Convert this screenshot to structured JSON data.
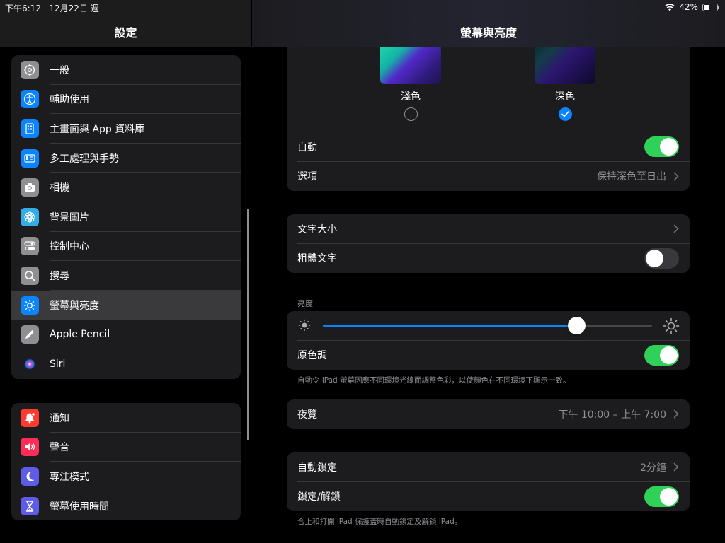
{
  "status": {
    "time": "下午6:12",
    "date": "12月22日 週一",
    "battery": "42%",
    "battery_level": 0.42
  },
  "sidebar": {
    "title": "設定",
    "group1": [
      {
        "label": "一般",
        "icon": "gear-icon",
        "color": "#8e8e93"
      },
      {
        "label": "輔助使用",
        "icon": "accessibility-icon",
        "color": "#0a84ff"
      },
      {
        "label": "主畫面與 App 資料庫",
        "icon": "home-screen-icon",
        "color": "#0a84ff"
      },
      {
        "label": "多工處理與手勢",
        "icon": "multitasking-icon",
        "color": "#0a84ff"
      },
      {
        "label": "相機",
        "icon": "camera-icon",
        "color": "#8e8e93"
      },
      {
        "label": "背景圖片",
        "icon": "flower-icon",
        "color": "#32ade6"
      },
      {
        "label": "控制中心",
        "icon": "toggles-icon",
        "color": "#8e8e93"
      },
      {
        "label": "搜尋",
        "icon": "search-icon",
        "color": "#8e8e93"
      },
      {
        "label": "螢幕與亮度",
        "icon": "sun-icon",
        "color": "#0a84ff",
        "selected": true
      },
      {
        "label": "Apple Pencil",
        "icon": "pencil-icon",
        "color": "#8e8e93"
      },
      {
        "label": "Siri",
        "icon": "siri-icon",
        "color": "#1c1c1e"
      }
    ],
    "group2": [
      {
        "label": "通知",
        "icon": "bell-icon",
        "color": "#ff3b30"
      },
      {
        "label": "聲音",
        "icon": "speaker-icon",
        "color": "#ff2d55"
      },
      {
        "label": "專注模式",
        "icon": "moon-icon",
        "color": "#5e5ce6"
      },
      {
        "label": "螢幕使用時間",
        "icon": "hourglass-icon",
        "color": "#5e5ce6"
      }
    ]
  },
  "main": {
    "title": "螢幕與亮度",
    "appearance": {
      "light_label": "淺色",
      "dark_label": "深色",
      "selected": "dark"
    },
    "auto_label": "自動",
    "auto_on": true,
    "options_label": "選項",
    "options_value": "保持深色至日出",
    "text_size_label": "文字大小",
    "bold_text_label": "粗體文字",
    "bold_text_on": false,
    "brightness_section": "亮度",
    "brightness_value": 0.77,
    "true_tone_label": "原色調",
    "true_tone_on": true,
    "true_tone_note": "自動令 iPad 螢幕因應不同環境光線而調整色彩，以使顏色在不同環境下顯示一致。",
    "night_shift_label": "夜覽",
    "night_shift_value": "下午 10:00 – 上午 7:00",
    "auto_lock_label": "自動鎖定",
    "auto_lock_value": "2分鐘",
    "lock_unlock_label": "鎖定/解鎖",
    "lock_unlock_on": true,
    "lock_note": "合上和打開 iPad 保護蓋時自動鎖定及解鎖 iPad。"
  },
  "colors": {
    "accent": "#0a84ff",
    "toggle_on": "#30d158",
    "background": "#000000",
    "card": "#1c1c1e"
  }
}
